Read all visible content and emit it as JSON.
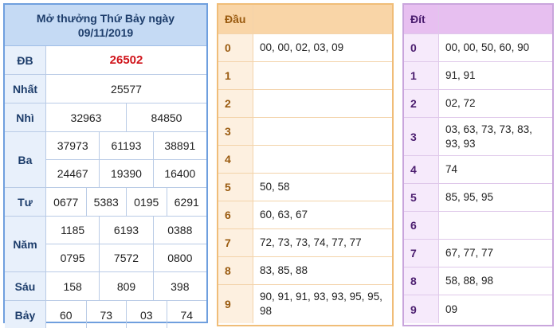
{
  "results": {
    "title_line1": "Mở thưởng Thứ Bảy ngày",
    "title_line2": "09/11/2019",
    "rows": [
      {
        "label": "ĐB",
        "lines": [
          [
            "26502"
          ]
        ]
      },
      {
        "label": "Nhất",
        "lines": [
          [
            "25577"
          ]
        ]
      },
      {
        "label": "Nhì",
        "lines": [
          [
            "32963",
            "84850"
          ]
        ]
      },
      {
        "label": "Ba",
        "lines": [
          [
            "37973",
            "61193",
            "38891"
          ],
          [
            "24467",
            "19390",
            "16400"
          ]
        ]
      },
      {
        "label": "Tư",
        "lines": [
          [
            "0677",
            "5383",
            "0195",
            "6291"
          ]
        ]
      },
      {
        "label": "Năm",
        "lines": [
          [
            "1185",
            "6193",
            "0388"
          ],
          [
            "0795",
            "7572",
            "0800"
          ]
        ]
      },
      {
        "label": "Sáu",
        "lines": [
          [
            "158",
            "809",
            "398"
          ]
        ]
      },
      {
        "label": "Bảy",
        "lines": [
          [
            "60",
            "73",
            "03",
            "74"
          ]
        ]
      }
    ]
  },
  "dau": {
    "header": "Đầu",
    "rows": [
      {
        "key": "0",
        "value": "00, 00, 02, 03, 09"
      },
      {
        "key": "1",
        "value": ""
      },
      {
        "key": "2",
        "value": ""
      },
      {
        "key": "3",
        "value": ""
      },
      {
        "key": "4",
        "value": ""
      },
      {
        "key": "5",
        "value": "50, 58"
      },
      {
        "key": "6",
        "value": "60, 63, 67"
      },
      {
        "key": "7",
        "value": "72, 73, 73, 74, 77, 77"
      },
      {
        "key": "8",
        "value": "83, 85, 88"
      },
      {
        "key": "9",
        "value": "90, 91, 91, 93, 93, 95, 95, 98"
      }
    ]
  },
  "dit": {
    "header": "Đít",
    "rows": [
      {
        "key": "0",
        "value": "00, 00, 50, 60, 90"
      },
      {
        "key": "1",
        "value": "91, 91"
      },
      {
        "key": "2",
        "value": "02, 72"
      },
      {
        "key": "3",
        "value": "03, 63, 73, 73, 83, 93, 93"
      },
      {
        "key": "4",
        "value": "74"
      },
      {
        "key": "5",
        "value": "85, 95, 95"
      },
      {
        "key": "6",
        "value": ""
      },
      {
        "key": "7",
        "value": "67, 77, 77"
      },
      {
        "key": "8",
        "value": "58, 88, 98"
      },
      {
        "key": "9",
        "value": "09"
      }
    ]
  },
  "colors": {
    "special_prize": "#d0141b",
    "results_border": "#6f9fde",
    "dau_border": "#f0bd78",
    "dit_border": "#c9a5dc"
  }
}
